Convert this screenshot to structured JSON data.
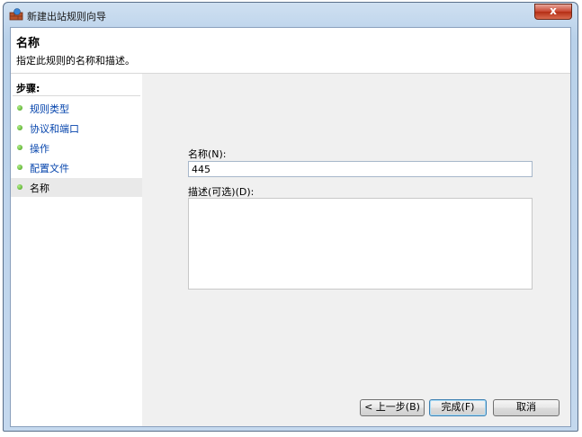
{
  "window": {
    "title": "新建出站规则向导",
    "close_glyph": "x"
  },
  "header": {
    "title": "名称",
    "description": "指定此规则的名称和描述。"
  },
  "steps": {
    "heading": "步骤:",
    "items": [
      {
        "label": "规则类型",
        "active": false
      },
      {
        "label": "协议和端口",
        "active": false
      },
      {
        "label": "操作",
        "active": false
      },
      {
        "label": "配置文件",
        "active": false
      },
      {
        "label": "名称",
        "active": true
      }
    ]
  },
  "form": {
    "name_label": "名称(N):",
    "name_value": "445",
    "description_label": "描述(可选)(D):",
    "description_value": ""
  },
  "buttons": {
    "back": "< 上一步(B)",
    "finish": "完成(F)",
    "cancel": "取消"
  },
  "colors": {
    "step_link": "#0645ad",
    "step_dot": "#3d9a14",
    "close_button": "#c8452f"
  }
}
